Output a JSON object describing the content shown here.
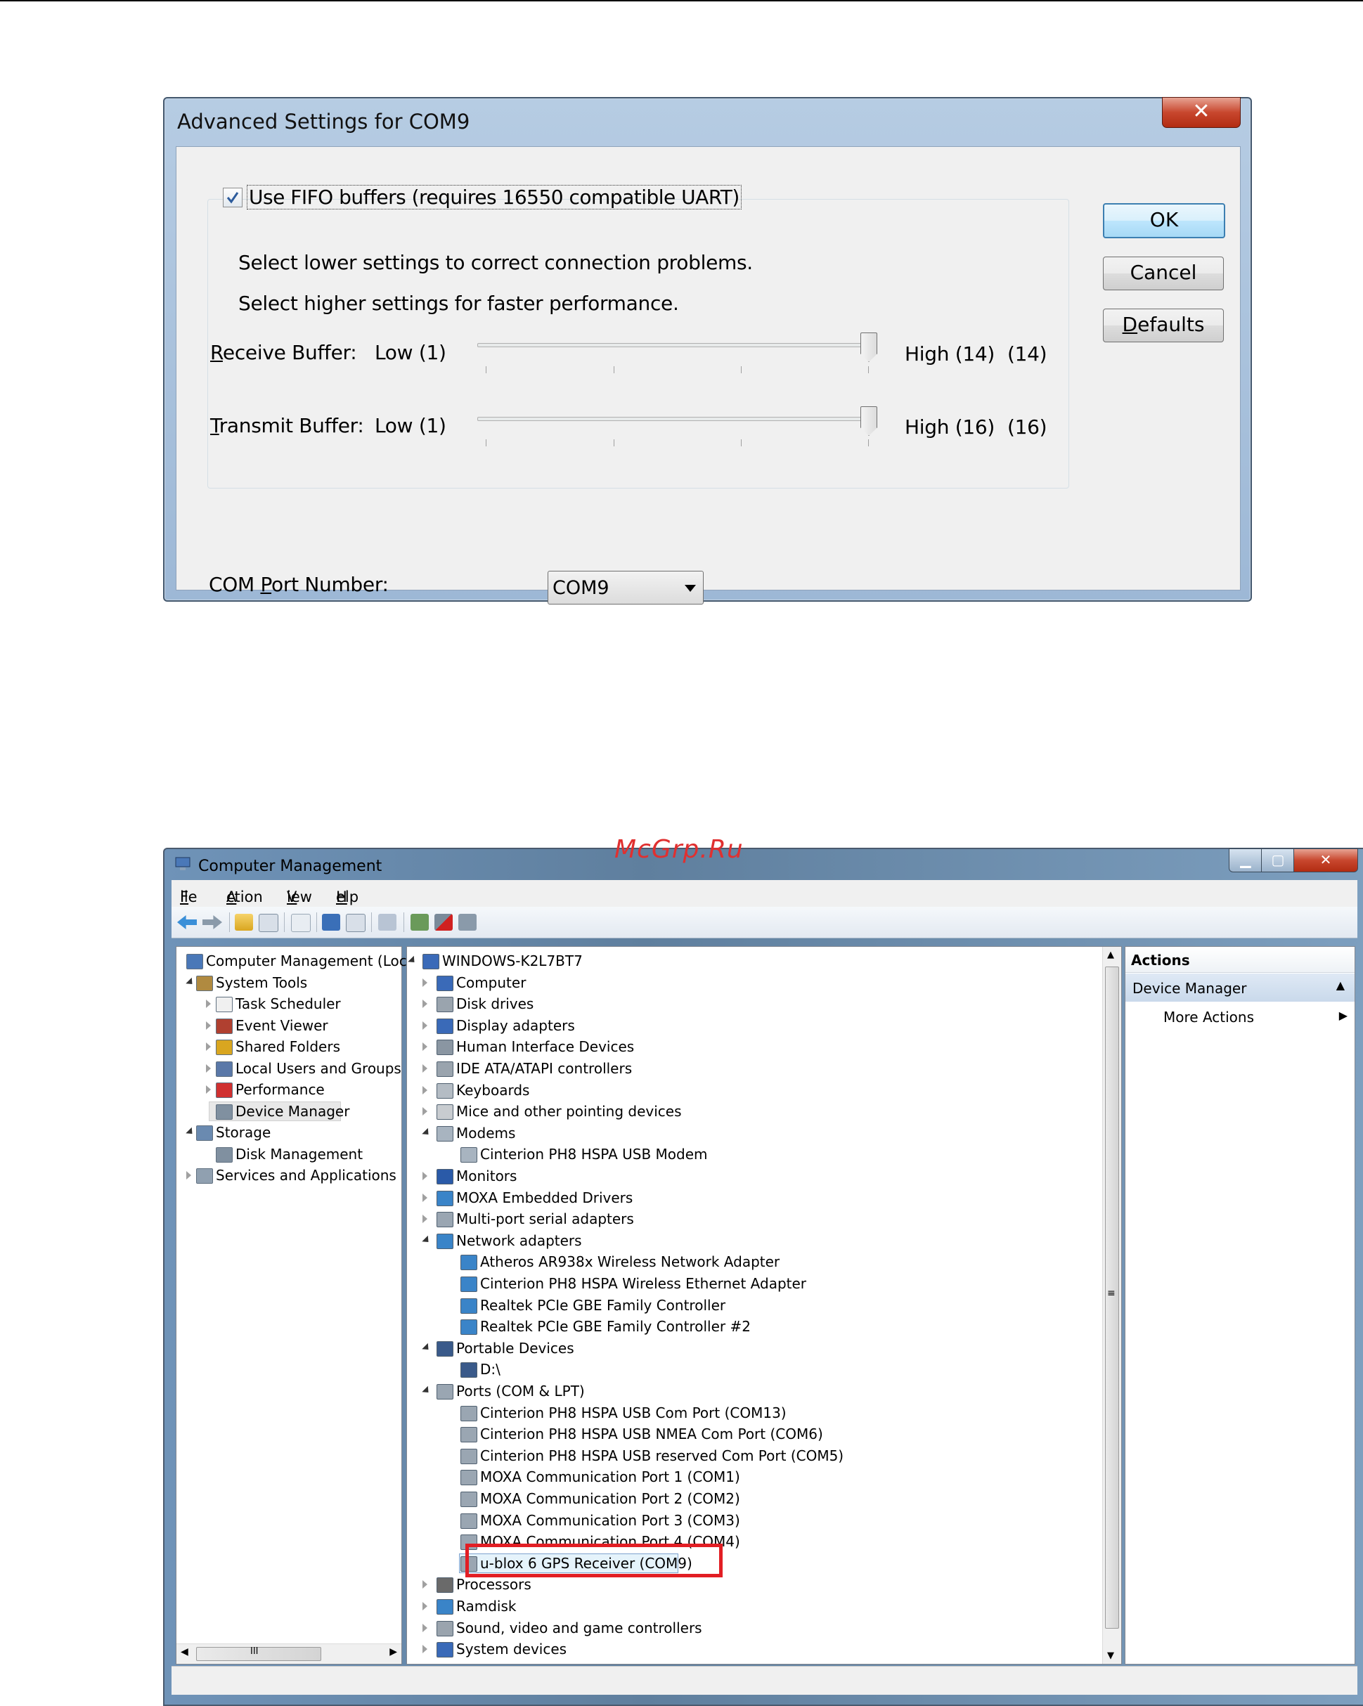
{
  "dialog": {
    "title": "Advanced Settings for COM9",
    "close_glyph": "✕",
    "fifo_checkbox": {
      "label": "Use FIFO buffers (requires 16550 compatible UART)",
      "checked": true
    },
    "hint_lower": "Select lower settings to correct connection problems.",
    "hint_higher": "Select higher settings for faster performance.",
    "receive": {
      "label_first": "R",
      "label_rest": "eceive Buffer:",
      "low": "Low (1)",
      "high": "High (14)",
      "value_text": "(14)",
      "value": 14,
      "max": 14
    },
    "transmit": {
      "label_first": "T",
      "label_rest": "ransmit Buffer:",
      "low": "Low (1)",
      "high": "High (16)",
      "value_text": "(16)",
      "value": 16,
      "max": 16
    },
    "com_port": {
      "label_a": "COM ",
      "label_u": "P",
      "label_b": "ort Number:",
      "value": "COM9"
    },
    "buttons": {
      "ok": "OK",
      "cancel": "Cancel",
      "defaults_u": "D",
      "defaults_rest": "efaults"
    }
  },
  "window": {
    "title": "Computer Management",
    "controls": {
      "min": "▁",
      "max": "▢",
      "close": "✕"
    },
    "menu": [
      {
        "u": "F",
        "rest": "ile"
      },
      {
        "u": "A",
        "rest": "ction"
      },
      {
        "u": "V",
        "rest": "iew"
      },
      {
        "u": "H",
        "rest": "elp"
      }
    ],
    "left_tree": [
      {
        "label": "Computer Management (Local",
        "icon": "computer-management-icon"
      },
      {
        "label": "System Tools",
        "icon": "system-tools-icon"
      },
      {
        "label": "Task Scheduler",
        "icon": "clock-icon"
      },
      {
        "label": "Event Viewer",
        "icon": "event-viewer-icon"
      },
      {
        "label": "Shared Folders",
        "icon": "shared-folder-icon"
      },
      {
        "label": "Local Users and Groups",
        "icon": "users-icon"
      },
      {
        "label": "Performance",
        "icon": "performance-icon"
      },
      {
        "label": "Device Manager",
        "icon": "device-manager-icon"
      },
      {
        "label": "Storage",
        "icon": "storage-icon"
      },
      {
        "label": "Disk Management",
        "icon": "disk-management-icon"
      },
      {
        "label": "Services and Applications",
        "icon": "services-icon"
      }
    ],
    "device_tree": [
      "WINDOWS-K2L7BT7",
      "Computer",
      "Disk drives",
      "Display adapters",
      "Human Interface Devices",
      "IDE ATA/ATAPI controllers",
      "Keyboards",
      "Mice and other pointing devices",
      "Modems",
      "Cinterion PH8 HSPA USB Modem",
      "Monitors",
      "MOXA Embedded Drivers",
      "Multi-port serial adapters",
      "Network adapters",
      "Atheros AR938x Wireless Network Adapter",
      "Cinterion PH8 HSPA Wireless Ethernet Adapter",
      "Realtek PCIe GBE Family Controller",
      "Realtek PCIe GBE Family Controller #2",
      "Portable Devices",
      "D:\\",
      "Ports (COM & LPT)",
      "Cinterion PH8 HSPA USB Com Port (COM13)",
      "Cinterion PH8 HSPA USB NMEA Com Port (COM6)",
      "Cinterion PH8 HSPA USB reserved Com Port (COM5)",
      "MOXA Communication Port 1 (COM1)",
      "MOXA Communication Port 2 (COM2)",
      "MOXA Communication Port 3 (COM3)",
      "MOXA Communication Port 4 (COM4)",
      "u-blox 6 GPS Receiver (COM9)",
      "Processors",
      "Ramdisk",
      "Sound, video and game controllers",
      "System devices"
    ],
    "actions": {
      "header": "Actions",
      "section": "Device Manager",
      "item": "More Actions"
    },
    "scroll_glyphs": {
      "up": "▲",
      "down": "▼",
      "left": "◀",
      "right": "▶",
      "grip": "≡",
      "hgrip": "III"
    }
  },
  "watermark": "McGrp.Ru"
}
